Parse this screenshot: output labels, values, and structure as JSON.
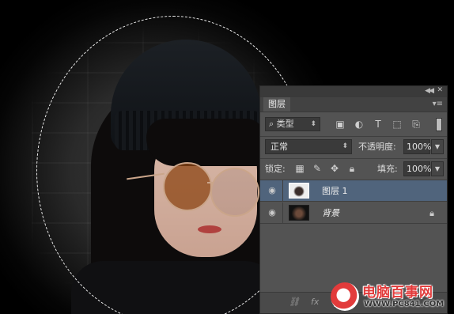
{
  "panel": {
    "tab_label": "图层",
    "filter": {
      "kind_label": "类型"
    },
    "blend_mode": "正常",
    "opacity_label": "不透明度:",
    "opacity_value": "100%",
    "lock_label": "锁定:",
    "fill_label": "填充:",
    "fill_value": "100%",
    "layers": [
      {
        "name": "图层 1",
        "selected": true
      },
      {
        "name": "背景",
        "selected": false,
        "locked": true
      }
    ]
  },
  "watermark": {
    "title": "电脑百事网",
    "url": "WWW.PC841.COM"
  }
}
